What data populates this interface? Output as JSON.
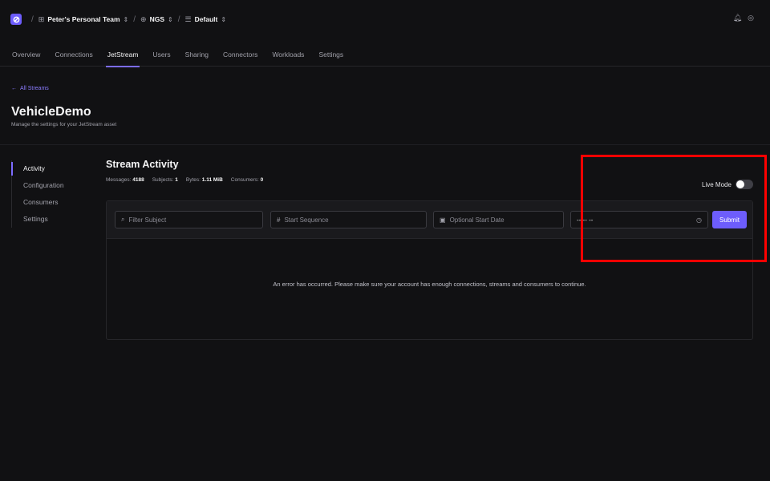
{
  "topbar": {
    "team": "Peter's Personal Team",
    "account": "NGS",
    "context": "Default",
    "icons": [
      "team-grid-icon",
      "globe-icon",
      "database-icon",
      "bell-icon",
      "user-circle-icon"
    ]
  },
  "tabs": [
    {
      "label": "Overview"
    },
    {
      "label": "Connections"
    },
    {
      "label": "JetStream",
      "active": true
    },
    {
      "label": "Users"
    },
    {
      "label": "Sharing"
    },
    {
      "label": "Connectors"
    },
    {
      "label": "Workloads"
    },
    {
      "label": "Settings"
    }
  ],
  "page": {
    "back_label": "All Streams",
    "title": "VehicleDemo",
    "subtitle": "Manage the settings for your JetStream asset"
  },
  "sidenav": [
    {
      "label": "Activity",
      "active": true
    },
    {
      "label": "Configuration"
    },
    {
      "label": "Consumers"
    },
    {
      "label": "Settings"
    }
  ],
  "activity": {
    "title": "Stream Activity",
    "stats": {
      "messages_label": "Messages:",
      "messages": "4188",
      "subjects_label": "Subjects:",
      "subjects": "1",
      "bytes_label": "Bytes:",
      "bytes": "1.11 MiB",
      "consumers_label": "Consumers:",
      "consumers": "0"
    },
    "live_mode_label": "Live Mode",
    "live_mode_on": false,
    "filters": {
      "subject_placeholder": "Filter Subject",
      "sequence_placeholder": "Start Sequence",
      "date_placeholder": "Optional Start Date",
      "time_value": "--:-- --",
      "submit_label": "Submit"
    },
    "error_message": "An error has occurred. Please make sure your account has enough connections, streams and consumers to continue."
  },
  "colors": {
    "accent": "#6d5dfc",
    "background": "#111113",
    "highlight": "#ff0000"
  }
}
